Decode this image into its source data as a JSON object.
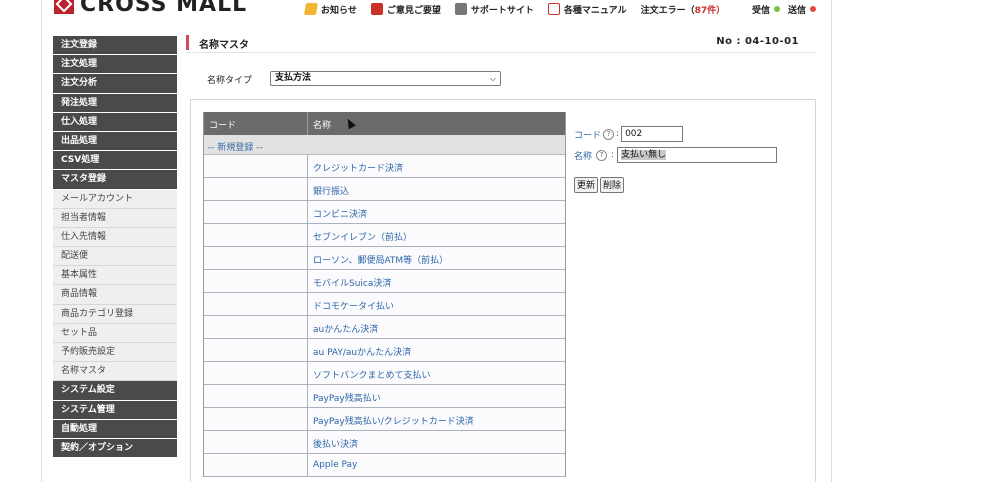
{
  "header": {
    "logo_text": "CROSS MALL",
    "nav": [
      {
        "label": "お知らせ",
        "icon": "megaphone-icon"
      },
      {
        "label": "ご意見ご要望",
        "icon": "opinion-box-icon"
      },
      {
        "label": "サポートサイト",
        "icon": "support-icon"
      },
      {
        "label": "各種マニュアル",
        "icon": "pdf-icon"
      }
    ],
    "order_error_label": "注文エラー（",
    "order_error_count": "87件",
    "order_error_suffix": "）",
    "receive_label": "受信",
    "send_label": "送信",
    "status_colors": {
      "receive": "#7cc242",
      "send": "#e24a4a"
    }
  },
  "sidebar": {
    "items": [
      {
        "label": "注文登録",
        "style": "dark"
      },
      {
        "label": "注文処理",
        "style": "dark"
      },
      {
        "label": "注文分析",
        "style": "dark"
      },
      {
        "label": "発注処理",
        "style": "dark"
      },
      {
        "label": "仕入処理",
        "style": "dark"
      },
      {
        "label": "出品処理",
        "style": "dark"
      },
      {
        "label": "CSV処理",
        "style": "dark"
      },
      {
        "label": "マスタ登録",
        "style": "dark"
      },
      {
        "label": "メールアカウント",
        "style": "light"
      },
      {
        "label": "担当者情報",
        "style": "light"
      },
      {
        "label": "仕入先情報",
        "style": "light"
      },
      {
        "label": "配送便",
        "style": "light"
      },
      {
        "label": "基本属性",
        "style": "light"
      },
      {
        "label": "商品情報",
        "style": "light"
      },
      {
        "label": "商品カテゴリ登録",
        "style": "light"
      },
      {
        "label": "セット品",
        "style": "light"
      },
      {
        "label": "予約販売設定",
        "style": "light"
      },
      {
        "label": "名称マスタ",
        "style": "light"
      },
      {
        "label": "システム設定",
        "style": "dark"
      },
      {
        "label": "システム管理",
        "style": "dark"
      },
      {
        "label": "自動処理",
        "style": "dark"
      },
      {
        "label": "契約／オプション",
        "style": "dark"
      }
    ]
  },
  "main": {
    "title": "名称マスタ",
    "page_no": "No : 04-10-01",
    "type_label": "名称タイプ",
    "type_value": "支払方法",
    "table": {
      "headers": [
        "コード",
        "名称"
      ],
      "new_entry": "-- 新規登録 --",
      "rows": [
        {
          "code": "",
          "name": "クレジットカード決済"
        },
        {
          "code": "",
          "name": "銀行振込"
        },
        {
          "code": "",
          "name": "コンビニ決済"
        },
        {
          "code": "",
          "name": "セブンイレブン（前払）"
        },
        {
          "code": "",
          "name": "ローソン、郵便局ATM等（前払）"
        },
        {
          "code": "",
          "name": "モバイルSuica決済"
        },
        {
          "code": "",
          "name": "ドコモケータイ払い"
        },
        {
          "code": "",
          "name": "auかんたん決済"
        },
        {
          "code": "",
          "name": "au PAY/auかんたん決済"
        },
        {
          "code": "",
          "name": "ソフトバンクまとめて支払い"
        },
        {
          "code": "",
          "name": "PayPay残高払い"
        },
        {
          "code": "",
          "name": "PayPay残高払い/クレジットカード決済"
        },
        {
          "code": "",
          "name": "後払い決済"
        },
        {
          "code": "",
          "name": "Apple Pay"
        }
      ]
    },
    "form": {
      "code_label": "コード",
      "code_value": "002",
      "name_label": "名称",
      "name_value": "支払い無し",
      "help_glyph": "?",
      "colon": ":",
      "update_button": "更新",
      "delete_button": "削除"
    }
  }
}
